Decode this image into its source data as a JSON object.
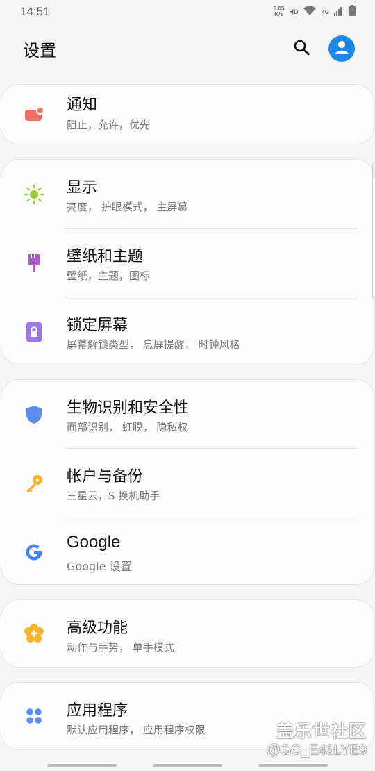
{
  "status_bar": {
    "time": "14:51",
    "net_speed_value": "0.05",
    "net_speed_unit": "K/s",
    "hd": "HD",
    "network_type": "4G"
  },
  "header": {
    "title": "设置"
  },
  "groups": [
    {
      "items": [
        {
          "title": "通知",
          "subtitle": "阻止，允许，优先",
          "icon": "notification-icon",
          "color": "#ef6f65"
        }
      ]
    },
    {
      "items": [
        {
          "title": "显示",
          "subtitle": "亮度， 护眼模式， 主屏幕",
          "icon": "brightness-icon",
          "color": "#9ccc3d"
        },
        {
          "title": "壁纸和主题",
          "subtitle": "壁纸，主题，图标",
          "icon": "paint-brush-icon",
          "color": "#ab5fc8"
        },
        {
          "title": "锁定屏幕",
          "subtitle": "屏幕解锁类型， 息屏提醒， 时钟风格",
          "icon": "lock-icon",
          "color": "#9c78e2"
        }
      ]
    },
    {
      "items": [
        {
          "title": "生物识别和安全性",
          "subtitle": "面部识别， 虹膜， 隐私权",
          "icon": "shield-icon",
          "color": "#5b8def"
        },
        {
          "title": "帐户与备份",
          "subtitle": "三星云，S 换机助手",
          "icon": "key-icon",
          "color": "#f5b531"
        },
        {
          "title": "Google",
          "subtitle": "Google 设置",
          "icon": "google-icon",
          "color": "#4285f4"
        }
      ]
    },
    {
      "items": [
        {
          "title": "高级功能",
          "subtitle": "动作与手势， 单手模式",
          "icon": "advanced-features-icon",
          "color": "#f5b531"
        }
      ]
    },
    {
      "items": [
        {
          "title": "应用程序",
          "subtitle": "默认应用程序， 应用程序权限",
          "icon": "apps-icon",
          "color": "#5b8def"
        }
      ]
    }
  ],
  "watermark": {
    "line1": "盖乐世社区",
    "line2": "@GC_E43LYE9"
  }
}
